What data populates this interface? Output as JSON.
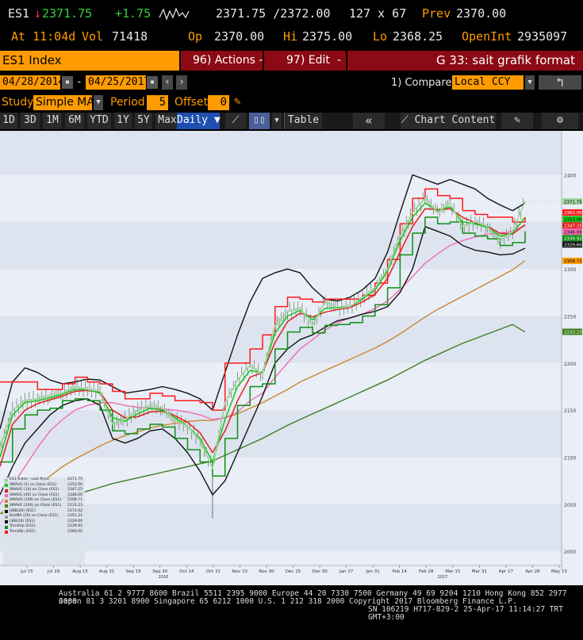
{
  "header": {
    "ticker": "ES1",
    "last": "2371.75",
    "change": "+1.75",
    "bid_ask": "2371.75 /2372.00",
    "size": "127 x 67",
    "prev_label": "Prev",
    "prev": "2370.00",
    "time": "At 11:04d",
    "vol_label": "Vol",
    "vol": "71418",
    "op_label": "Op",
    "op": "2370.00",
    "hi_label": "Hi",
    "hi": "2375.00",
    "lo_label": "Lo",
    "lo": "2368.25",
    "oi_label": "OpenInt",
    "oi": "2935097"
  },
  "toolbar1": {
    "security": "ES1 Index",
    "actions": "96) Actions -",
    "edit": "97) Edit",
    "edit_arrow": "-",
    "title": "G 33: sait grafik format"
  },
  "toolbar2": {
    "start_date": "04/28/2014",
    "sep": "-",
    "end_date": "04/25/2017",
    "compare_label": "1) Compare",
    "compare_value": "Local CCY"
  },
  "toolbar3": {
    "study_label": "Study",
    "study_value": "Simple MA",
    "period_label": "Period",
    "period_value": "5",
    "offset_label": "Offset",
    "offset_value": "0"
  },
  "toolbar4": {
    "ranges": [
      "1D",
      "3D",
      "1M",
      "6M",
      "YTD",
      "1Y",
      "5Y",
      "Max"
    ],
    "frequency": "Daily",
    "table": "Table",
    "chart_content": "Chart Content"
  },
  "chart_data": {
    "type": "line",
    "x_tick_labels": [
      "Jul 15",
      "Jul 29",
      "Aug 15",
      "Aug 31",
      "Sep 15",
      "Sep 30",
      "Oct 14",
      "Oct 31",
      "Nov 15",
      "Nov 30",
      "Dec 15",
      "Dec 30",
      "Jan 17",
      "Jan 31",
      "Feb 14",
      "Feb 28",
      "Mar 15",
      "Mar 31",
      "Apr 17",
      "Apr 28",
      "May 15"
    ],
    "year_labels": [
      "2016",
      "2017"
    ],
    "y_tick_labels": [
      "2400",
      "2350",
      "2300",
      "2250",
      "2200",
      "2150",
      "2100",
      "2050",
      "2000"
    ],
    "ylim": [
      1985,
      2440
    ],
    "x": [
      "Jul 08",
      "Jul 15",
      "Jul 22",
      "Jul 29",
      "Aug 05",
      "Aug 12",
      "Aug 19",
      "Aug 26",
      "Sep 02",
      "Sep 09",
      "Sep 16",
      "Sep 23",
      "Sep 30",
      "Oct 07",
      "Oct 14",
      "Oct 21",
      "Oct 28",
      "Nov 04",
      "Nov 11",
      "Nov 18",
      "Nov 25",
      "Dec 02",
      "Dec 09",
      "Dec 16",
      "Dec 23",
      "Dec 30",
      "Jan 06",
      "Jan 13",
      "Jan 20",
      "Jan 27",
      "Feb 03",
      "Feb 10",
      "Feb 17",
      "Feb 24",
      "Mar 03",
      "Mar 10",
      "Mar 17",
      "Mar 24",
      "Mar 31",
      "Apr 07",
      "Apr 14",
      "Apr 21",
      "Apr 25"
    ],
    "series": [
      {
        "name": "ES1 Index - Last Price",
        "color": "#9ed59a",
        "values": [
          2110,
          2150,
          2160,
          2162,
          2165,
          2168,
          2175,
          2172,
          2170,
          2135,
          2140,
          2150,
          2155,
          2152,
          2140,
          2133,
          2118,
          2088,
          2158,
          2182,
          2198,
          2188,
          2240,
          2255,
          2258,
          2240,
          2265,
          2258,
          2260,
          2270,
          2280,
          2300,
          2335,
          2360,
          2375,
          2360,
          2370,
          2345,
          2350,
          2345,
          2330,
          2340,
          2372
        ]
      },
      {
        "name": "SMAVG (5) on Close (ES1)",
        "color": "#18c41c",
        "values": [
          2100,
          2145,
          2158,
          2160,
          2163,
          2167,
          2172,
          2172,
          2168,
          2142,
          2138,
          2146,
          2152,
          2150,
          2142,
          2133,
          2120,
          2095,
          2140,
          2175,
          2192,
          2190,
          2232,
          2250,
          2256,
          2246,
          2258,
          2259,
          2260,
          2268,
          2278,
          2298,
          2330,
          2355,
          2370,
          2362,
          2366,
          2350,
          2348,
          2344,
          2335,
          2338,
          2355
        ]
      },
      {
        "name": "SMAVG (10) on Close (ES1)",
        "color": "#e02020",
        "values": [
          2090,
          2135,
          2150,
          2157,
          2161,
          2165,
          2170,
          2171,
          2169,
          2150,
          2142,
          2143,
          2148,
          2149,
          2144,
          2137,
          2126,
          2105,
          2128,
          2160,
          2185,
          2190,
          2222,
          2244,
          2253,
          2249,
          2254,
          2257,
          2259,
          2265,
          2273,
          2290,
          2318,
          2345,
          2364,
          2363,
          2364,
          2355,
          2349,
          2345,
          2338,
          2337,
          2347
        ]
      },
      {
        "name": "SMAVG (40) on Close (ES1)",
        "color": "#f06cb4",
        "values": [
          2050,
          2070,
          2090,
          2110,
          2128,
          2140,
          2150,
          2155,
          2158,
          2158,
          2155,
          2153,
          2152,
          2151,
          2150,
          2148,
          2145,
          2140,
          2142,
          2148,
          2160,
          2168,
          2185,
          2200,
          2215,
          2225,
          2235,
          2243,
          2248,
          2252,
          2258,
          2266,
          2278,
          2292,
          2306,
          2316,
          2325,
          2330,
          2334,
          2337,
          2338,
          2340,
          2346
        ]
      },
      {
        "name": "SMAVG (100) on Close (ES1)",
        "color": "#c8882e",
        "values": [
          2040,
          2050,
          2060,
          2070,
          2080,
          2090,
          2098,
          2105,
          2112,
          2118,
          2123,
          2127,
          2131,
          2134,
          2136,
          2138,
          2139,
          2139,
          2142,
          2146,
          2152,
          2158,
          2165,
          2172,
          2180,
          2186,
          2192,
          2198,
          2204,
          2210,
          2216,
          2223,
          2231,
          2240,
          2249,
          2257,
          2264,
          2271,
          2278,
          2285,
          2292,
          2299,
          2309
        ]
      },
      {
        "name": "SMAVG (200) on Close (ES1)",
        "color": "#3e7f1f",
        "values": [
          2040,
          2042,
          2045,
          2048,
          2052,
          2056,
          2060,
          2064,
          2068,
          2072,
          2075,
          2078,
          2081,
          2084,
          2087,
          2090,
          2093,
          2096,
          2102,
          2108,
          2114,
          2120,
          2127,
          2134,
          2140,
          2146,
          2152,
          2158,
          2164,
          2170,
          2176,
          2182,
          2189,
          2196,
          2203,
          2209,
          2215,
          2221,
          2226,
          2231,
          2236,
          2241,
          2233
        ]
      },
      {
        "name": "Upper Bollinger",
        "color": "#111111",
        "values": [
          2130,
          2180,
          2195,
          2190,
          2182,
          2178,
          2180,
          2183,
          2182,
          2175,
          2168,
          2170,
          2172,
          2175,
          2172,
          2168,
          2162,
          2150,
          2190,
          2230,
          2265,
          2290,
          2296,
          2300,
          2296,
          2280,
          2268,
          2266,
          2270,
          2278,
          2290,
          2318,
          2360,
          2400,
          2395,
          2390,
          2395,
          2390,
          2385,
          2375,
          2368,
          2362,
          2370
        ]
      },
      {
        "name": "Lower Bollinger",
        "color": "#111111",
        "values": [
          2060,
          2090,
          2115,
          2130,
          2145,
          2155,
          2160,
          2162,
          2155,
          2120,
          2115,
          2120,
          2128,
          2130,
          2120,
          2105,
          2085,
          2060,
          2075,
          2105,
          2135,
          2165,
          2200,
          2215,
          2225,
          2230,
          2238,
          2245,
          2248,
          2252,
          2255,
          2260,
          2275,
          2300,
          2345,
          2340,
          2335,
          2325,
          2320,
          2318,
          2315,
          2316,
          2322
        ]
      },
      {
        "name": "TrendUp (ES1)",
        "color": "#0e8f12",
        "values": [
          2095,
          2130,
          2145,
          2150,
          2152,
          2160,
          2162,
          2160,
          2150,
          2128,
          2125,
          2130,
          2135,
          2132,
          2120,
          2108,
          2095,
          2080,
          2120,
          2155,
          2175,
          2178,
          2215,
          2233,
          2238,
          2232,
          2240,
          2241,
          2243,
          2250,
          2262,
          2280,
          2315,
          2338,
          2355,
          2348,
          2350,
          2338,
          2335,
          2332,
          2325,
          2328,
          2340
        ]
      },
      {
        "name": "TrendDn (ES1)",
        "color": "#ff1a1a",
        "values": [
          2180,
          2180,
          2180,
          2172,
          2172,
          2178,
          2185,
          2180,
          2178,
          2170,
          2162,
          2162,
          2168,
          2165,
          2160,
          2160,
          2158,
          2150,
          2200,
          2200,
          2215,
          2230,
          2260,
          2270,
          2268,
          2265,
          2268,
          2268,
          2268,
          2272,
          2285,
          2310,
          2348,
          2375,
          2385,
          2378,
          2375,
          2362,
          2358,
          2355,
          2355,
          2350,
          2355
        ]
      }
    ],
    "legend_entries": [
      {
        "name": "ES1 Index - Last Price",
        "value": "2371.75",
        "color": "#9ed59a"
      },
      {
        "name": "SMAVG (5) on Close (ES1)",
        "value": "2353.00",
        "color": "#18c41c"
      },
      {
        "name": "SMAVG (10) on Close (ES1)",
        "value": "2347.25",
        "color": "#e02020"
      },
      {
        "name": "SMAVG (40) on Close (ES1)",
        "value": "2346.00",
        "color": "#f06cb4"
      },
      {
        "name": "SMAVG (100) on Close (ES1)",
        "value": "2308.71",
        "color": "#c8882e"
      },
      {
        "name": "SMAVG (200) on Close (ES1)",
        "value": "2233.23",
        "color": "#3e7f1f"
      },
      {
        "name": "UBB(20) (ES1)",
        "value": "2373.02",
        "color": "#111111"
      },
      {
        "name": "BollMA (20) on Close (ES1)",
        "value": "2351.31",
        "color": "#999999"
      },
      {
        "name": "LBB(20) (ES1)",
        "value": "2329.60",
        "color": "#111111"
      },
      {
        "name": "TrendUp (ES1)",
        "value": "2339.92",
        "color": "#0e8f12"
      },
      {
        "name": "TrendDn (ES1)",
        "value": "2360.00",
        "color": "#ff1a1a"
      }
    ],
    "right_axis_tags": [
      {
        "value": "2371.75",
        "color": "#9ed59a"
      },
      {
        "value": "2360.00",
        "color": "#ff1a1a"
      },
      {
        "value": "2353.00",
        "color": "#18c41c"
      },
      {
        "value": "2347.25",
        "color": "#e02020"
      },
      {
        "value": "2346.00",
        "color": "#f06cb4"
      },
      {
        "value": "2339.92",
        "color": "#0e8f12"
      },
      {
        "value": "2329.60",
        "color": "#111111"
      },
      {
        "value": "2308.71",
        "color": "#ff9b00"
      },
      {
        "value": "2233.23",
        "color": "#3e7f1f"
      }
    ]
  },
  "footer": {
    "line1": "Australia 61 2 9777 8600 Brazil 5511 2395 9000 Europe 44 20 7330 7500 Germany 49 69 9204 1210 Hong Kong 852 2977 6000",
    "line2": "Japan 81 3 3201 8900        Singapore 65 6212 1000        U.S. 1 212 318 2000              Copyright 2017 Bloomberg Finance L.P.",
    "line3": "SN 106219 H717-829-2 25-Apr-17 11:14:27 TRT  GMT+3:00"
  }
}
